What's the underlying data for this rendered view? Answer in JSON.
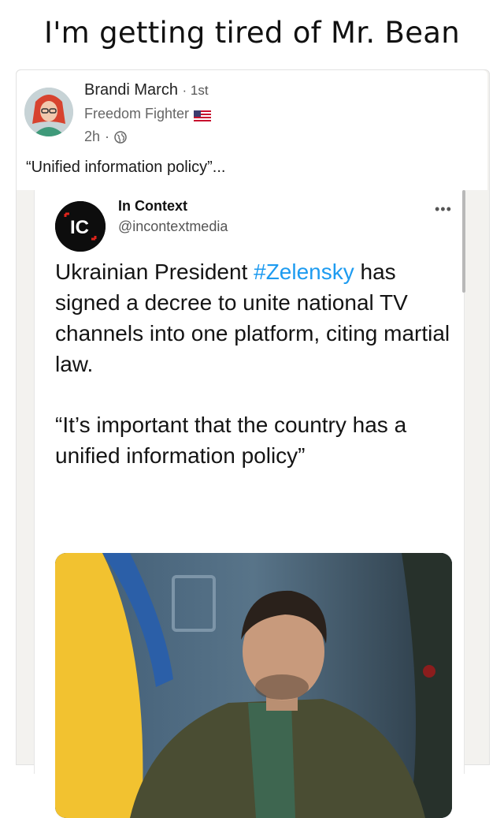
{
  "meme": {
    "title": "I'm getting tired of Mr. Bean"
  },
  "post": {
    "author_name": "Brandi March",
    "connection_degree": "1st",
    "headline": "Freedom Fighter",
    "headline_icon": "us-flag-icon",
    "time": "2h",
    "visibility_icon": "globe-icon",
    "text": "“Unified information policy”..."
  },
  "tweet": {
    "account_name": "In Context",
    "handle": "@incontextmedia",
    "logo_text": "IC",
    "more_icon": "more-horizontal-icon",
    "body_before": "Ukrainian President ",
    "hashtag": "#Zelensky",
    "body_after": " has signed a decree to unite national TV channels into one platform, citing martial law.",
    "quote": "“It’s important that the country has a unified information policy”",
    "image": "photo-man-in-green-jacket-with-ukrainian-flag"
  },
  "colors": {
    "hashtag": "#1d9bf0",
    "card_background": "#f3f2ef",
    "flag_yellow": "#f2c230",
    "flag_blue": "#2b5fa8",
    "logo_accent": "#e0241b"
  }
}
